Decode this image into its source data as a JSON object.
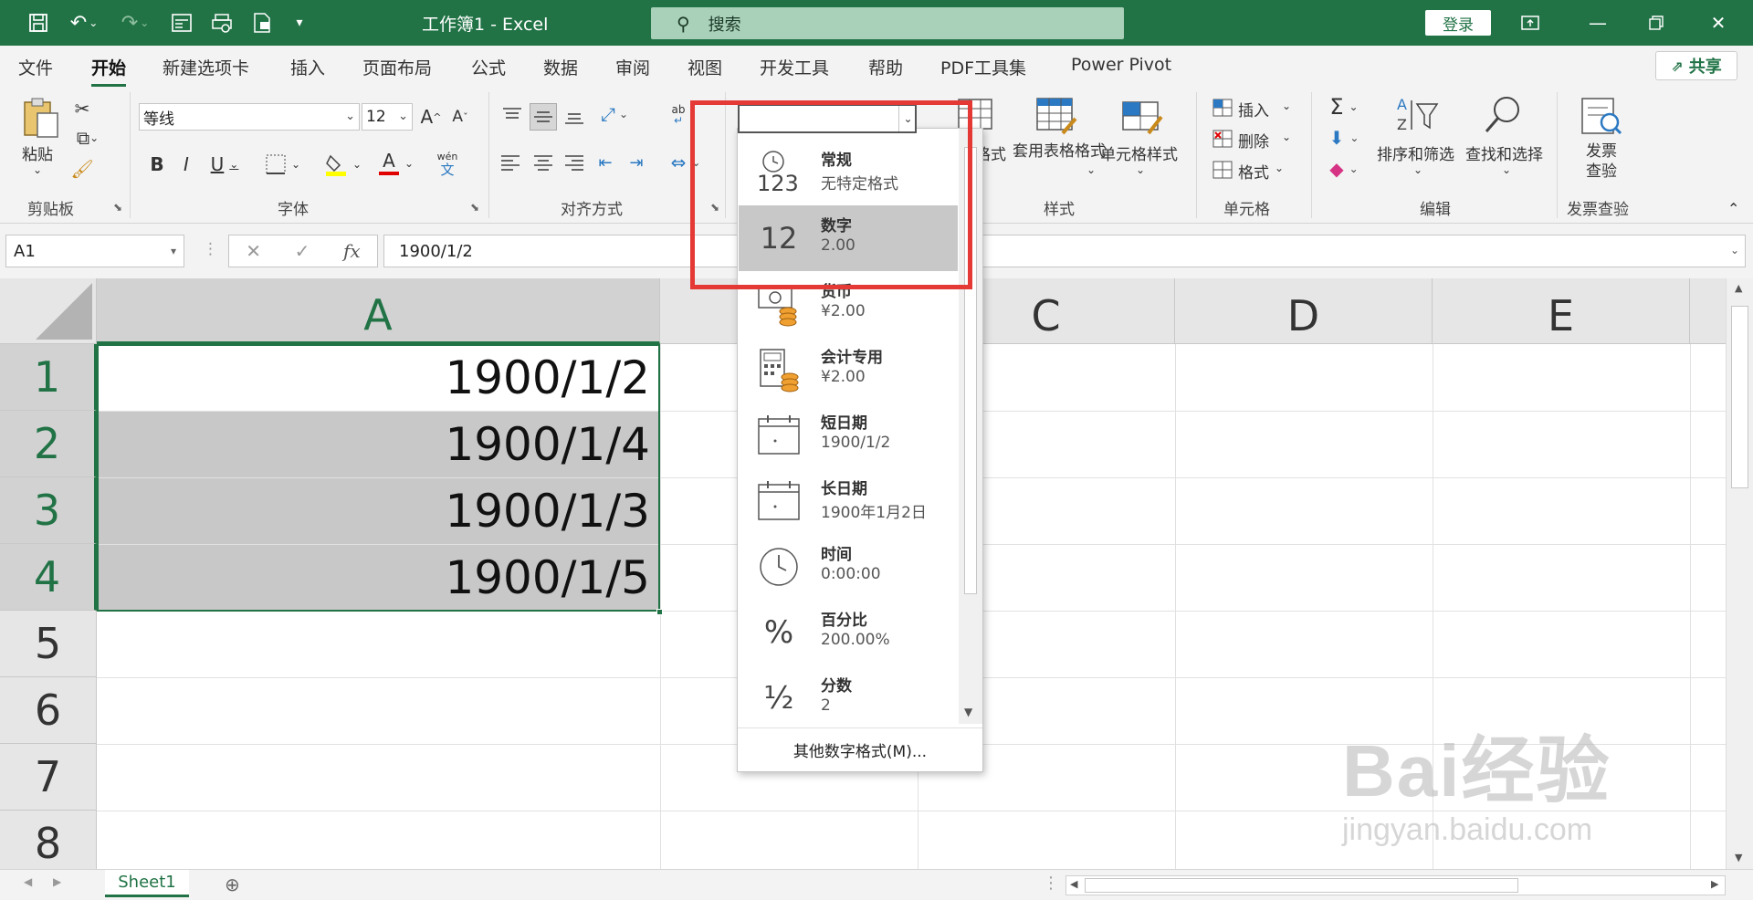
{
  "titlebar": {
    "title": "工作簿1 - Excel",
    "search_placeholder": "搜索",
    "login": "登录"
  },
  "tabs": [
    "文件",
    "开始",
    "新建选项卡",
    "插入",
    "页面布局",
    "公式",
    "数据",
    "审阅",
    "视图",
    "开发工具",
    "帮助",
    "PDF工具集",
    "Power Pivot"
  ],
  "active_tab": "开始",
  "share_label": "共享",
  "ribbon": {
    "clipboard": {
      "paste": "粘贴",
      "label": "剪贴板"
    },
    "font": {
      "name": "等线",
      "size": "12",
      "label": "字体",
      "phonetic": "wén"
    },
    "alignment": {
      "label": "对齐方式"
    },
    "styles": {
      "cond_format_partial": "格式",
      "table_format": "套用表格格式",
      "cell_styles": "单元格样式",
      "label": "样式"
    },
    "cells": {
      "insert": "插入",
      "delete": "删除",
      "format": "格式",
      "label": "单元格"
    },
    "editing": {
      "sort_filter": "排序和筛选",
      "find_select": "查找和选择",
      "label": "编辑"
    },
    "invoice": {
      "check": "发票查验",
      "label": "发票查验"
    }
  },
  "formula_bar": {
    "name_box": "A1",
    "formula": "1900/1/2"
  },
  "columns": [
    "A",
    "C",
    "D",
    "E"
  ],
  "rows": [
    "1",
    "2",
    "3",
    "4",
    "5",
    "6",
    "7",
    "8"
  ],
  "cells": [
    "1900/1/2",
    "1900/1/4",
    "1900/1/3",
    "1900/1/5"
  ],
  "number_format_dropdown": {
    "items": [
      {
        "icon": "123",
        "name": "常规",
        "sample": "无特定格式"
      },
      {
        "icon": "12",
        "name": "数字",
        "sample": "2.00"
      },
      {
        "icon": "currency",
        "name": "货币",
        "sample": "¥2.00"
      },
      {
        "icon": "accounting",
        "name": "会计专用",
        "sample": " ¥2.00"
      },
      {
        "icon": "calendar",
        "name": "短日期",
        "sample": "1900/1/2"
      },
      {
        "icon": "calendar",
        "name": "长日期",
        "sample": "1900年1月2日"
      },
      {
        "icon": "clock",
        "name": "时间",
        "sample": "0:00:00"
      },
      {
        "icon": "%",
        "name": "百分比",
        "sample": "200.00%"
      },
      {
        "icon": "½",
        "name": "分数",
        "sample": "2"
      }
    ],
    "selected": "数字",
    "more": "其他数字格式(M)..."
  },
  "sheet_tab": "Sheet1",
  "watermark": {
    "big": "Bai经验",
    "small": "jingyan.baidu.com"
  },
  "colors": {
    "brand": "#217346",
    "highlight": "#e53935"
  }
}
